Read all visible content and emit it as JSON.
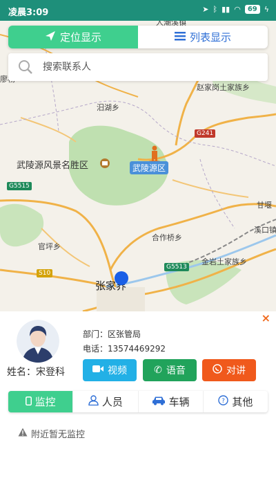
{
  "status_bar": {
    "time": "凌晨3:09",
    "battery": "69"
  },
  "view_switch": {
    "locate_label": "定位显示",
    "list_label": "列表显示"
  },
  "search": {
    "placeholder": "搜索联系人"
  },
  "map": {
    "labels": {
      "renchao": "人潮溪镇",
      "zhao": "赵家岗土家族乡",
      "ruhu": "汨湖乡",
      "scenic": "武陵源风景名胜区",
      "district": "武陵源区",
      "hezuo": "合作桥乡",
      "guanping": "官坪乡",
      "jinyan": "金岩土家族乡",
      "ganfang": "甘堰",
      "xikou": "溪口镇",
      "city": "张家界",
      "top_left": "廖杨"
    },
    "roads": {
      "g241": "G241",
      "g5515": "G5515",
      "g5513": "G5513",
      "s10": "S10"
    }
  },
  "contact": {
    "dept_label": "部门：区张管局",
    "phone_label": "电话：13574469292",
    "name_label": "姓名：宋登科",
    "close_icon": "×"
  },
  "actions": {
    "video": "视频",
    "voice": "语音",
    "talk": "对讲"
  },
  "tabs": [
    {
      "label": "监控",
      "icon": "phone-icon",
      "active": true
    },
    {
      "label": "人员",
      "icon": "person-icon",
      "active": false
    },
    {
      "label": "车辆",
      "icon": "car-icon",
      "active": false
    },
    {
      "label": "其他",
      "icon": "question-icon",
      "active": false
    }
  ],
  "empty_message": "附近暂无监控",
  "colors": {
    "accent": "#3fcf8e",
    "status_bar": "#1e8f7a",
    "video": "#22b0e6",
    "voice": "#21a35b",
    "talk": "#f0591c",
    "link": "#2f6fd6"
  }
}
